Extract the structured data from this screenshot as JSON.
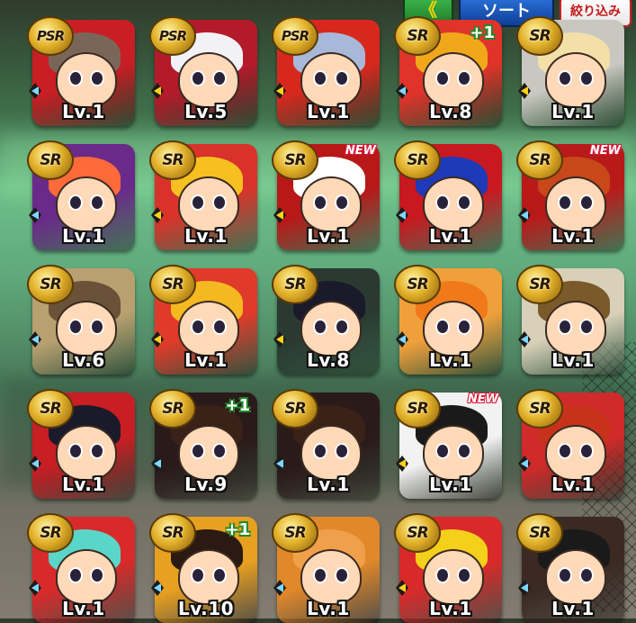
{
  "topbar": {
    "back_icon": "double-chevron-left-icon",
    "back_label": "《",
    "sort_label": "ソート",
    "filter_label": "絞り込み"
  },
  "colors": {
    "arrow_blue": "#7fd6ff",
    "arrow_yellow": "#ffd21a",
    "new_red": "#d81b3a",
    "plus_green": "#1e8a2a"
  },
  "cards": [
    {
      "rarity": "PSR",
      "level": "Lv.1",
      "tag": "",
      "arrow": "blue",
      "bg": "#c81e24",
      "hair": "#7a6658"
    },
    {
      "rarity": "PSR",
      "level": "Lv.5",
      "tag": "",
      "arrow": "yellow",
      "bg": "#b41a2a",
      "hair": "#f2f2f6"
    },
    {
      "rarity": "PSR",
      "level": "Lv.1",
      "tag": "",
      "arrow": "yellow",
      "bg": "#d8281e",
      "hair": "#a8b8d8"
    },
    {
      "rarity": "SR",
      "level": "Lv.8",
      "tag": "+1",
      "arrow": "blue",
      "bg": "#e0342a",
      "hair": "#f0a81a"
    },
    {
      "rarity": "SR",
      "level": "Lv.1",
      "tag": "",
      "arrow": "yellow",
      "bg": "#c8c8c0",
      "hair": "#f2e0a8"
    },
    {
      "rarity": "SR",
      "level": "Lv.1",
      "tag": "",
      "arrow": "blue",
      "bg": "#6a2a8a",
      "hair": "#ff6a3a"
    },
    {
      "rarity": "SR",
      "level": "Lv.1",
      "tag": "",
      "arrow": "yellow",
      "bg": "#d8322a",
      "hair": "#f5c020"
    },
    {
      "rarity": "SR",
      "level": "Lv.1",
      "tag": "NEW",
      "arrow": "yellow",
      "bg": "#b81818",
      "hair": "#ffffff"
    },
    {
      "rarity": "SR",
      "level": "Lv.1",
      "tag": "",
      "arrow": "blue",
      "bg": "#c81820",
      "hair": "#1e3ab8"
    },
    {
      "rarity": "SR",
      "level": "Lv.1",
      "tag": "NEW",
      "arrow": "blue",
      "bg": "#b81a1a",
      "hair": "#c8481a"
    },
    {
      "rarity": "SR",
      "level": "Lv.6",
      "tag": "",
      "arrow": "blue",
      "bg": "#b8a070",
      "hair": "#6a5238"
    },
    {
      "rarity": "SR",
      "level": "Lv.1",
      "tag": "",
      "arrow": "yellow",
      "bg": "#e03a2a",
      "hair": "#f5b820"
    },
    {
      "rarity": "SR",
      "level": "Lv.8",
      "tag": "",
      "arrow": "yellow",
      "bg": "#2a3a32",
      "hair": "#1a1a2a"
    },
    {
      "rarity": "SR",
      "level": "Lv.1",
      "tag": "",
      "arrow": "blue",
      "bg": "#f0a03a",
      "hair": "#f07a1a"
    },
    {
      "rarity": "SR",
      "level": "Lv.1",
      "tag": "",
      "arrow": "blue",
      "bg": "#d8d0b8",
      "hair": "#7a5a2a"
    },
    {
      "rarity": "SR",
      "level": "Lv.1",
      "tag": "",
      "arrow": "blue",
      "bg": "#c81e24",
      "hair": "#1a1a2a"
    },
    {
      "rarity": "SR",
      "level": "Lv.9",
      "tag": "+1",
      "arrow": "blue",
      "bg": "#2a1a1a",
      "hair": "#3a2218"
    },
    {
      "rarity": "SR",
      "level": "Lv.1",
      "tag": "",
      "arrow": "blue",
      "bg": "#2a1a1a",
      "hair": "#3a2218"
    },
    {
      "rarity": "SR",
      "level": "Lv.1",
      "tag": "NEW",
      "arrow": "yellow",
      "bg": "#f2f2f2",
      "hair": "#1a1a1a"
    },
    {
      "rarity": "SR",
      "level": "Lv.1",
      "tag": "",
      "arrow": "blue",
      "bg": "#d02a2a",
      "hair": "#c8321a"
    },
    {
      "rarity": "SR",
      "level": "Lv.1",
      "tag": "",
      "arrow": "blue",
      "bg": "#d82a2a",
      "hair": "#5ad6c8"
    },
    {
      "rarity": "SR",
      "level": "Lv.10",
      "tag": "+1",
      "arrow": "blue",
      "bg": "#e8a020",
      "hair": "#2a1a12"
    },
    {
      "rarity": "SR",
      "level": "Lv.1",
      "tag": "",
      "arrow": "blue",
      "bg": "#e0882a",
      "hair": "#f0a04a"
    },
    {
      "rarity": "SR",
      "level": "Lv.1",
      "tag": "",
      "arrow": "yellow",
      "bg": "#d82a2a",
      "hair": "#f5d01a"
    },
    {
      "rarity": "SR",
      "level": "Lv.1",
      "tag": "",
      "arrow": "blue",
      "bg": "#3a2a22",
      "hair": "#1a1a1a"
    }
  ]
}
